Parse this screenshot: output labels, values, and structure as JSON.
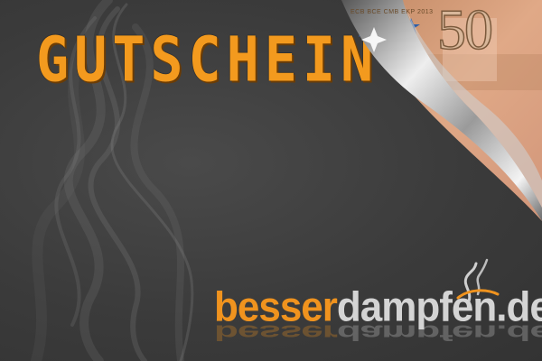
{
  "title": "GUTSCHEIN",
  "banknote": {
    "value": "50",
    "issuer_text": "ECB BCE CMB EKP 2013"
  },
  "brand": {
    "part1": "besser",
    "part2": "dampfen.de"
  },
  "colors": {
    "accent": "#f0931e",
    "background": "#3a3a3a",
    "brand_grey": "#d4d4d4"
  }
}
